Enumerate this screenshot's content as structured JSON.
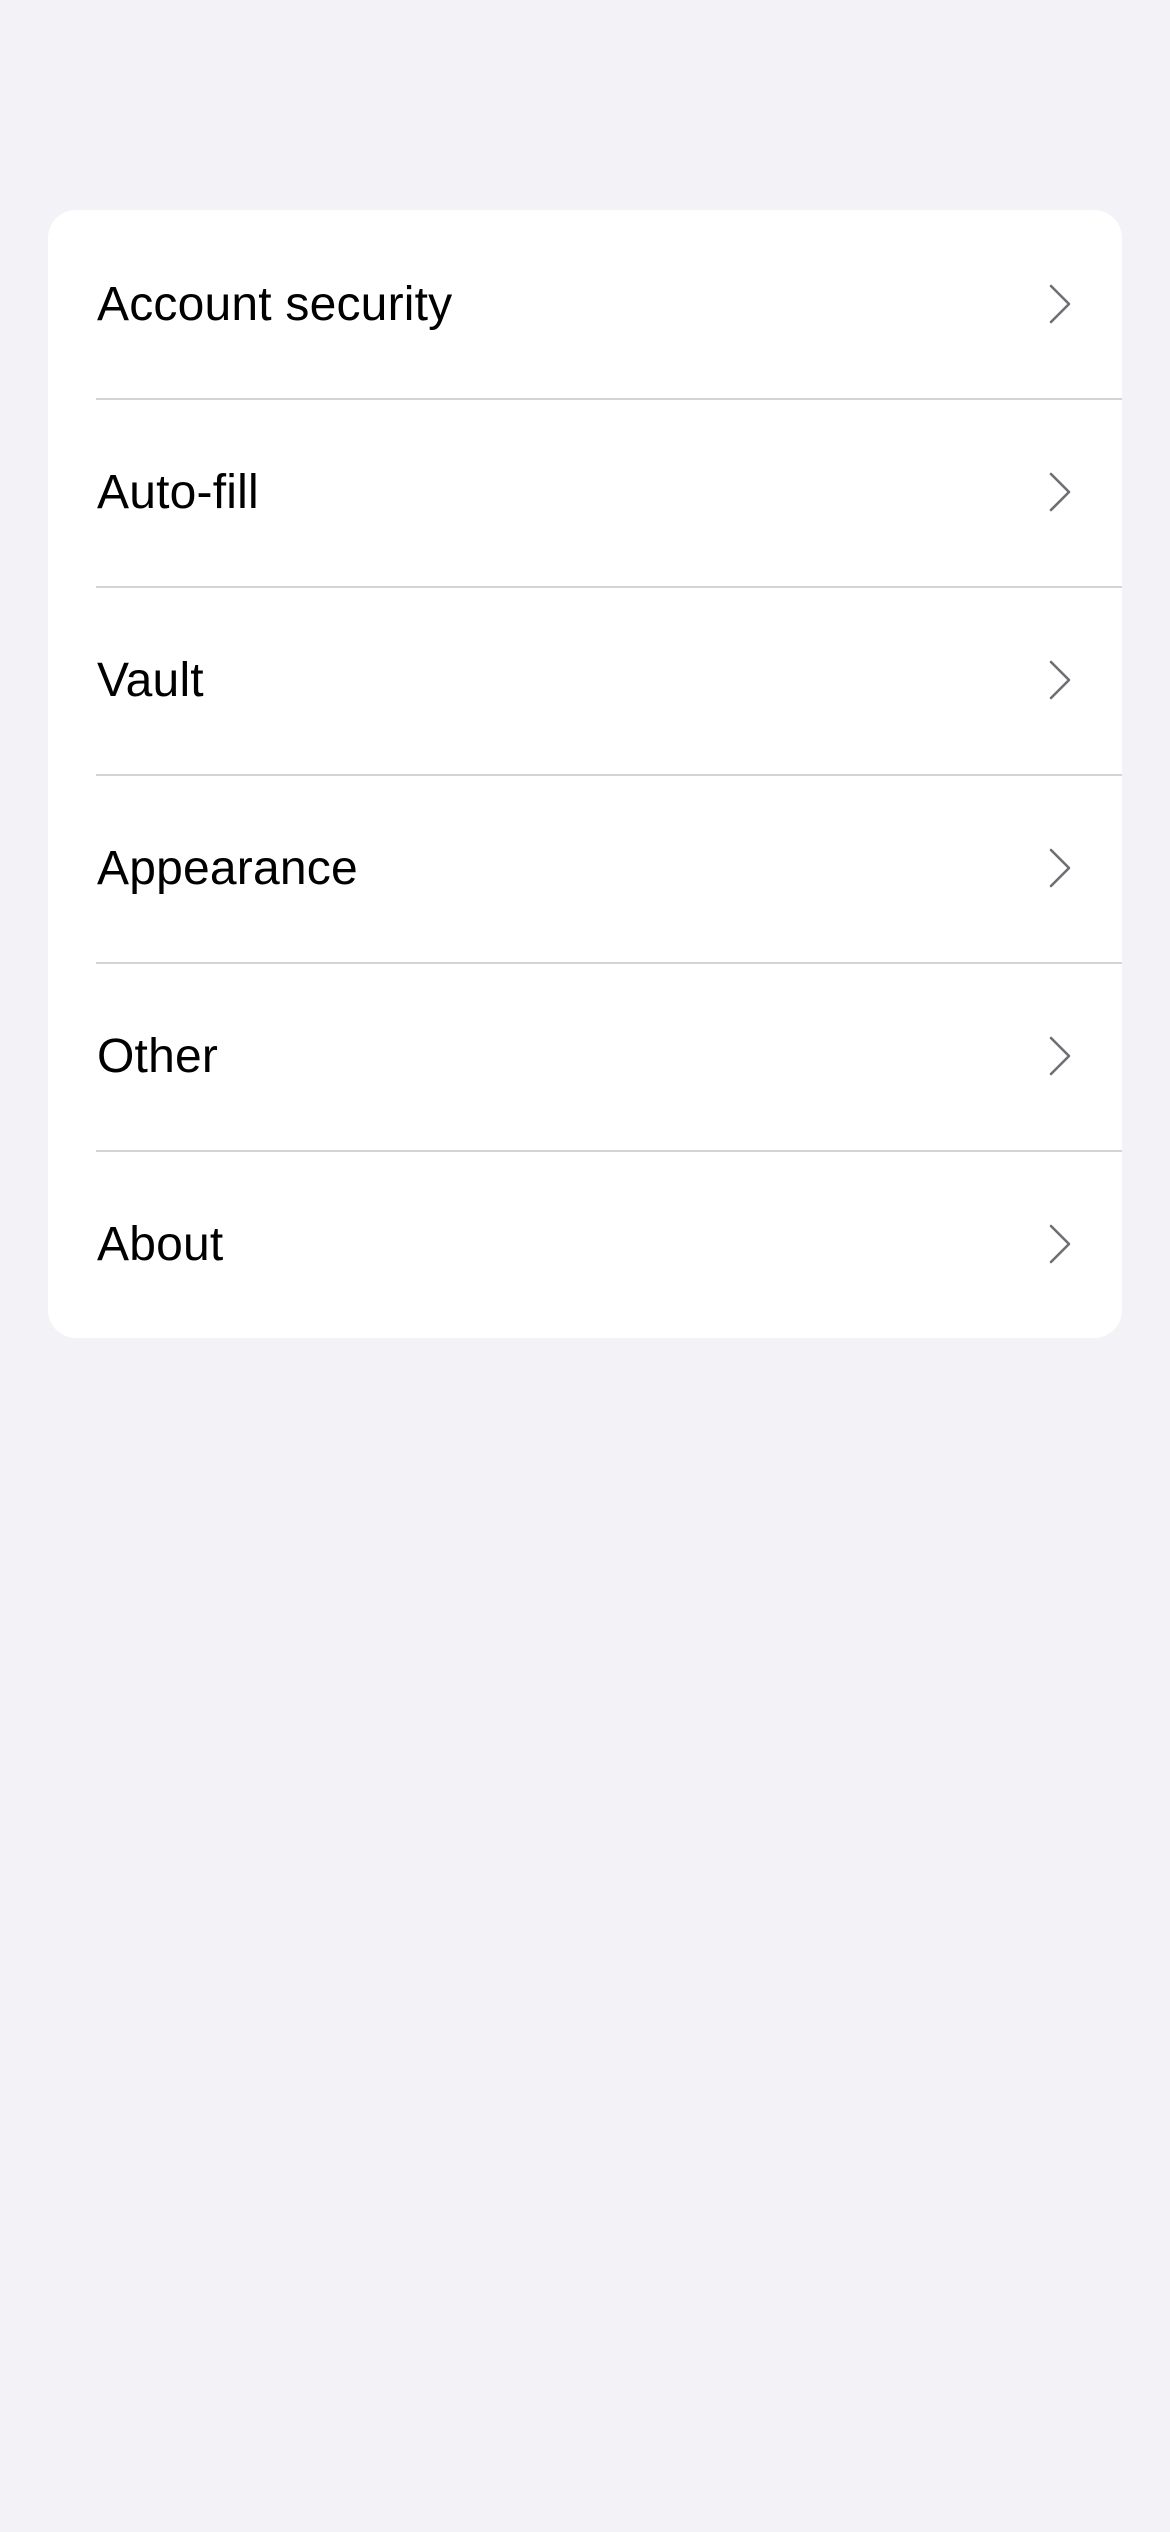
{
  "settings": {
    "items": [
      {
        "label": "Account security",
        "icon": "chevron-right-icon"
      },
      {
        "label": "Auto-fill",
        "icon": "chevron-right-icon"
      },
      {
        "label": "Vault",
        "icon": "chevron-right-icon"
      },
      {
        "label": "Appearance",
        "icon": "chevron-right-icon"
      },
      {
        "label": "Other",
        "icon": "chevron-right-icon"
      },
      {
        "label": "About",
        "icon": "chevron-right-icon"
      }
    ]
  },
  "colors": {
    "background": "#f2f2f7",
    "card": "#ffffff",
    "separator": "#d4d4d8",
    "text": "#000000",
    "chevron": "#6e6e73"
  }
}
